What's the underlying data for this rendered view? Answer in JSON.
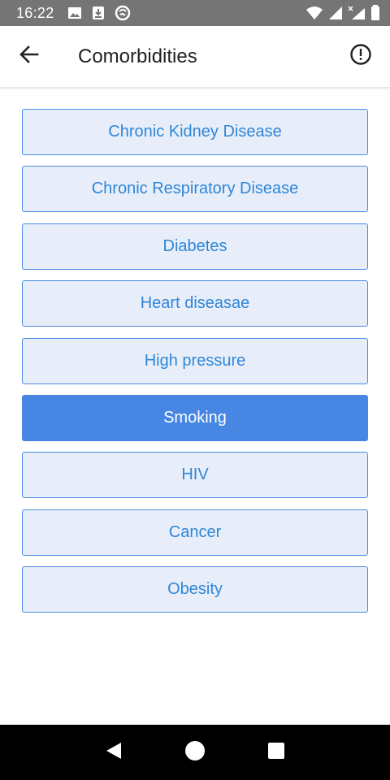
{
  "status_bar": {
    "time": "16:22",
    "left_icons": [
      "image-icon",
      "download-icon",
      "vpn-icon"
    ],
    "right_icons": [
      "wifi-icon",
      "signal-icon",
      "signal-no-data-icon",
      "battery-icon"
    ]
  },
  "app_bar": {
    "title": "Comorbidities",
    "back_icon": "back-arrow-icon",
    "info_icon": "info-circle-icon"
  },
  "comorbidities": {
    "items": [
      {
        "label": "Chronic Kidney Disease",
        "selected": false
      },
      {
        "label": "Chronic Respiratory Disease",
        "selected": false
      },
      {
        "label": "Diabetes",
        "selected": false
      },
      {
        "label": "Heart diseasae",
        "selected": false
      },
      {
        "label": "High pressure",
        "selected": false
      },
      {
        "label": "Smoking",
        "selected": true
      },
      {
        "label": "HIV",
        "selected": false
      },
      {
        "label": "Cancer",
        "selected": false
      },
      {
        "label": "Obesity",
        "selected": false
      }
    ]
  },
  "colors": {
    "accent": "#4787e3",
    "item_background": "#e8eef9",
    "item_text": "#2f86d8",
    "status_bar": "#757575"
  },
  "nav_bar": {
    "icons": [
      "back-triangle-icon",
      "home-circle-icon",
      "recents-square-icon"
    ]
  }
}
